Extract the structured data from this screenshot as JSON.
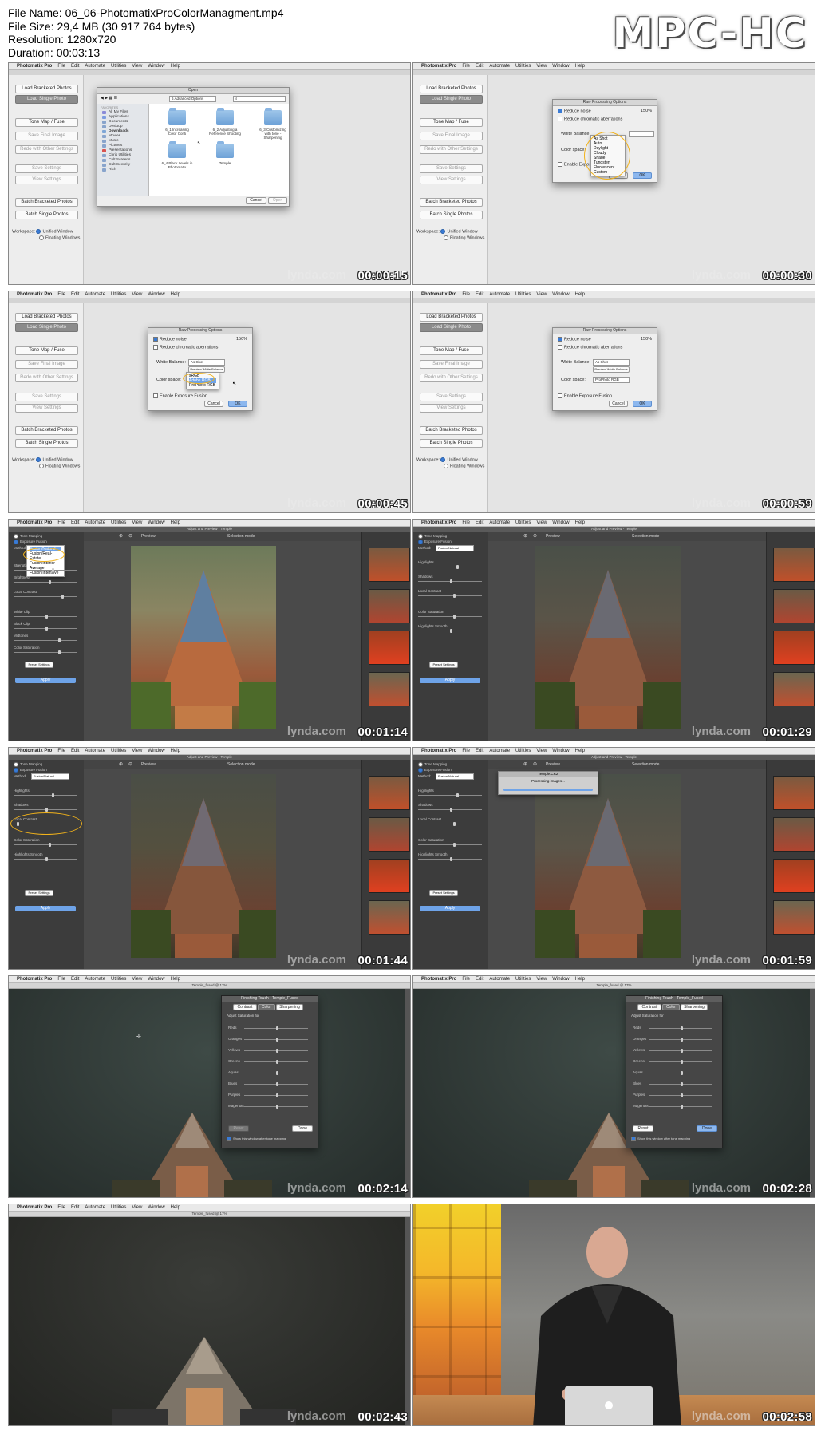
{
  "header": {
    "file_name": "File Name: 06_06-PhotomatixProColorManagment.mp4",
    "file_size": "File Size: 29,4 MB (30 917 764 bytes)",
    "resolution": "Resolution: 1280x720",
    "duration": "Duration: 00:03:13",
    "logo": "MPC-HC"
  },
  "app": {
    "name": "Photomatix Pro",
    "menus": [
      "File",
      "Edit",
      "Automate",
      "Utilities",
      "View",
      "Window",
      "Help"
    ]
  },
  "sidebar": {
    "buttons": [
      "Load Bracketed Photos",
      "Load Single Photo",
      "Tone Map / Fuse",
      "Save Final Image",
      "Redo with Other Settings",
      "Save Settings",
      "View Settings",
      "Batch Bracketed Photos",
      "Batch Single Photos"
    ],
    "workspace_label": "Workspace:",
    "workspace_options": [
      "Unified Window",
      "Floating Windows"
    ]
  },
  "open_dialog": {
    "title": "Open",
    "location": "6 Advanced Options",
    "sidebar_header": "FAVORITES",
    "sidebar_items": [
      "All My Files",
      "Applications",
      "Documents",
      "Desktop",
      "Downloads",
      "Movies",
      "Music",
      "Pictures",
      "Presentations",
      "Chris Utilities",
      "Cult Screens",
      "Cult Security",
      "Rich"
    ],
    "files": [
      "6_1 Increasing Color Conti",
      "6_2 Adjusting a Reference Shooting",
      "6_3 Customizing with tone - Sharpening",
      "6_4 Black Levels in Photomatix",
      "Temple"
    ],
    "cancel": "Cancel",
    "open": "Open"
  },
  "raw_dialog": {
    "title": "Raw Processing Options",
    "reduce_noise": "Reduce noise",
    "noise_value": "150%",
    "reduce_ca": "Reduce chromatic aberrations",
    "white_balance_label": "White Balance:",
    "white_balance_value": "As Shot",
    "preview_wb": "Preview White Balance",
    "color_space_label": "Color space:",
    "color_space_value": "ProPhoto RGB",
    "fusion": "Enable Exposure Fusion",
    "cancel": "Cancel",
    "ok": "OK",
    "wb_options": [
      "As Shot",
      "Auto",
      "Daylight",
      "Cloudy",
      "Shade",
      "Tungsten",
      "Fluorescent",
      "Custom"
    ],
    "cs_options": [
      "sRGB",
      "Adobe RGB",
      "ProPhoto RGB"
    ]
  },
  "tone_panel": {
    "process_tone": "Tone Mapping",
    "process_fusion": "Exposure Fusion",
    "method_label": "Method:",
    "method_value": "Fusion/Natural",
    "method_options": [
      "Fusion/Natural",
      "Fusion/Real-Estate",
      "Fusion/Interior",
      "Average",
      "Fusion/Intensive"
    ],
    "sliders": [
      "Strength",
      "Brightness",
      "Local Contrast",
      "White Clip",
      "Black Clip",
      "Midtones",
      "Color Saturation"
    ],
    "sliders_b": [
      "Highlights",
      "Shadows",
      "Local Contrast",
      "Color Saturation",
      "Highlights Smooth"
    ],
    "preset_button": "Preset Settings",
    "apply": "Apply",
    "selection_mode": "Selection mode",
    "preview": "Preview",
    "window_title": "Adjust and Preview - Temple",
    "processing_title": "Temple.CR2",
    "processing_text": "Processing images..."
  },
  "saturation_dialog": {
    "title": "Finishing Touch - Temple_Fused",
    "tabs": [
      "Contrast",
      "Color",
      "Sharpening"
    ],
    "label": "Adjust Saturation for",
    "channels": [
      "Reds",
      "Oranges",
      "Yellows",
      "Greens",
      "Aquas",
      "Blues",
      "Purples",
      "Magentas"
    ],
    "reset": "Reset",
    "done": "Done",
    "footer": "Show this window after tone mapping",
    "doc_title": "Temple_fused @ 17%"
  },
  "watermark": "lynda.com",
  "frames": [
    {
      "time": "00:00:15"
    },
    {
      "time": "00:00:30"
    },
    {
      "time": "00:00:45"
    },
    {
      "time": "00:00:59"
    },
    {
      "time": "00:01:14"
    },
    {
      "time": "00:01:29"
    },
    {
      "time": "00:01:44"
    },
    {
      "time": "00:01:59"
    },
    {
      "time": "00:02:14"
    },
    {
      "time": "00:02:28"
    },
    {
      "time": "00:02:43"
    },
    {
      "time": "00:02:58"
    }
  ]
}
